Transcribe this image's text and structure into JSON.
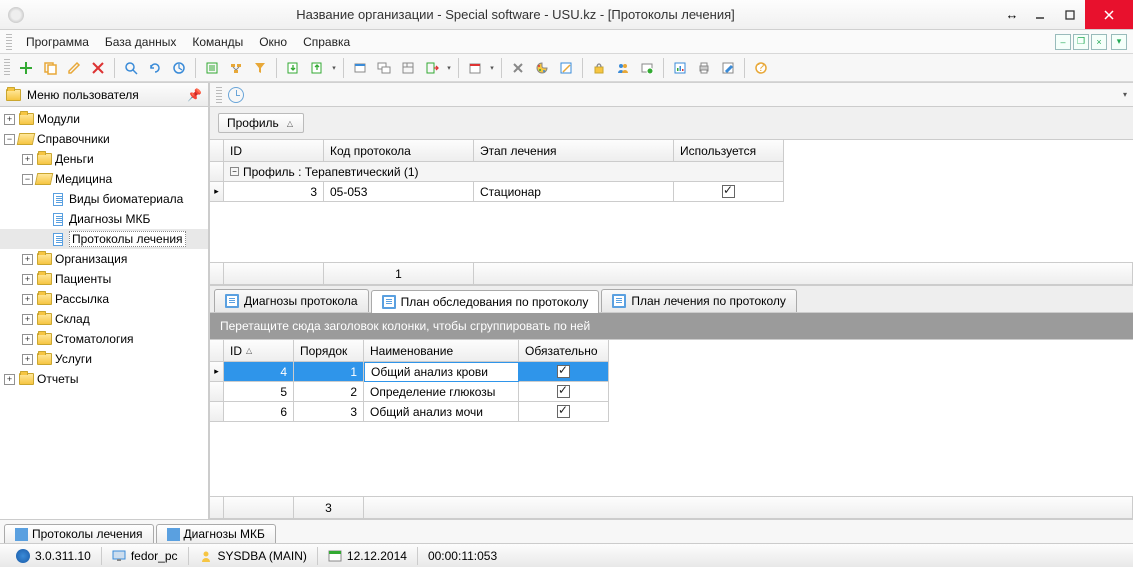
{
  "window": {
    "title": "Название организации - Special software - USU.kz - [Протоколы лечения]"
  },
  "menu": [
    "Программа",
    "База данных",
    "Команды",
    "Окно",
    "Справка"
  ],
  "sidebar": {
    "title": "Меню пользователя",
    "items": {
      "modules": "Модули",
      "refs": "Справочники",
      "money": "Деньги",
      "medicine": "Медицина",
      "bio": "Виды биоматериала",
      "mkb": "Диагнозы МКБ",
      "protocols": "Протоколы лечения",
      "org": "Организация",
      "patients": "Пациенты",
      "mailing": "Рассылка",
      "stock": "Склад",
      "dental": "Стоматология",
      "services": "Услуги",
      "reports": "Отчеты"
    }
  },
  "groupField": "Профиль",
  "grid1": {
    "cols": {
      "id": "ID",
      "code": "Код протокола",
      "stage": "Этап лечения",
      "used": "Используется"
    },
    "groupRow": "Профиль : Терапевтический (1)",
    "rows": [
      {
        "id": "3",
        "code": "05-053",
        "stage": "Стационар",
        "used": true
      }
    ],
    "footerCount": "1"
  },
  "subtabs": {
    "diag": "Диагнозы протокола",
    "plan": "План обследования по протоколу",
    "treat": "План лечения по протоколу"
  },
  "groupHint": "Перетащите сюда заголовок колонки, чтобы сгруппировать по ней",
  "grid2": {
    "cols": {
      "id": "ID",
      "order": "Порядок",
      "name": "Наименование",
      "req": "Обязательно"
    },
    "rows": [
      {
        "id": "4",
        "order": "1",
        "name": "Общий анализ крови",
        "req": true
      },
      {
        "id": "5",
        "order": "2",
        "name": "Определение глюкозы",
        "req": true
      },
      {
        "id": "6",
        "order": "3",
        "name": "Общий анализ мочи",
        "req": true
      }
    ],
    "footerCount": "3"
  },
  "footerTabs": {
    "protocols": "Протоколы лечения",
    "mkb": "Диагнозы МКБ"
  },
  "status": {
    "version": "3.0.311.10",
    "host": "fedor_pc",
    "user": "SYSDBA (MAIN)",
    "date": "12.12.2014",
    "time": "00:00:11:053"
  }
}
